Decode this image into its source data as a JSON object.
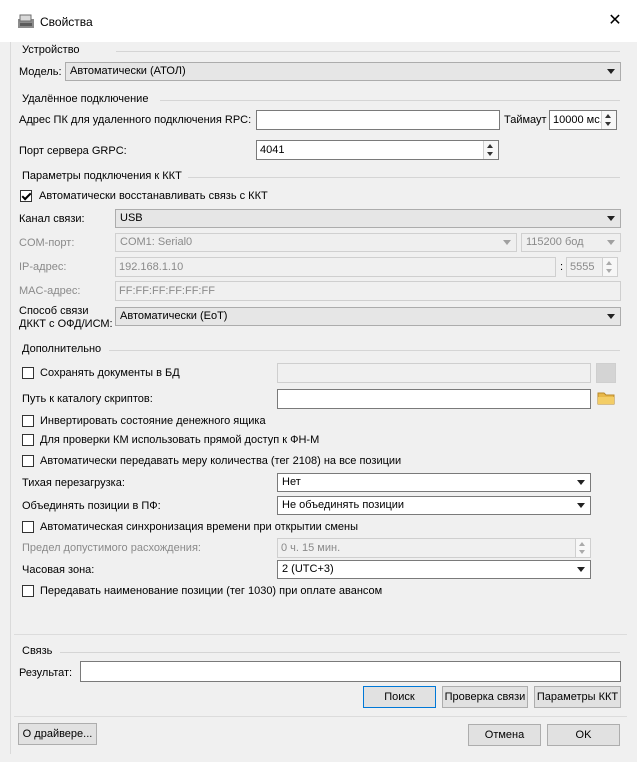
{
  "window": {
    "title": "Свойства",
    "close": "✕"
  },
  "device": {
    "section": "Устройство",
    "model_label": "Модель:",
    "model_value": "Автоматически (АТОЛ)"
  },
  "remote": {
    "section": "Удалённое подключение",
    "rpc_label": "Адрес ПК для удаленного подключения RPC:",
    "rpc_value": "",
    "timeout_label": "Таймаут",
    "timeout_value": "10000 мс.",
    "grpc_label": "Порт сервера GRPC:",
    "grpc_value": "4041"
  },
  "kkt": {
    "section": "Параметры подключения к ККТ",
    "auto_reconnect": "Автоматически восстанавливать связь с ККТ",
    "channel_label": "Канал связи:",
    "channel_value": "USB",
    "com_label": "COM-порт:",
    "com_value": "COM1: Serial0",
    "baud_value": "115200 бод",
    "ip_label": "IP-адрес:",
    "ip_value": "192.168.1.10",
    "ip_sep": ":",
    "port_value": "5555",
    "mac_label": "MAC-адрес:",
    "mac_value": "FF:FF:FF:FF:FF:FF",
    "ofd_label_1": "Способ связи",
    "ofd_label_2": "ДККТ с ОФД/ИСМ:",
    "ofd_value": "Автоматически (EoT)"
  },
  "extra": {
    "section": "Дополнительно",
    "save_docs": "Сохранять документы в БД",
    "save_docs_value": "",
    "scripts_label": "Путь к каталогу скриптов:",
    "scripts_value": "",
    "invert_drawer": "Инвертировать состояние денежного ящика",
    "km_direct": "Для проверки КМ использовать прямой доступ к ФН-М",
    "auto_qty": "Автоматически передавать меру количества (тег 2108) на все позиции",
    "silent_label": "Тихая перезагрузка:",
    "silent_value": "Нет",
    "merge_label": "Объединять позиции в ПФ:",
    "merge_value": "Не объединять позиции",
    "time_sync": "Автоматическая синхронизация времени при открытии смены",
    "tolerance_label": "Предел допустимого расхождения:",
    "tolerance_value": "0 ч. 15 мин.",
    "tz_label": "Часовая зона:",
    "tz_value": "2 (UTC+3)",
    "send_name": "Передавать наименование позиции (тег 1030) при оплате авансом"
  },
  "link": {
    "section": "Связь",
    "result_label": "Результат:",
    "result_value": "",
    "search_btn": "Поиск",
    "check_btn": "Проверка связи",
    "params_btn": "Параметры ККТ"
  },
  "footer": {
    "about_btn": "О драйвере...",
    "cancel_btn": "Отмена",
    "ok_btn": "OK"
  }
}
